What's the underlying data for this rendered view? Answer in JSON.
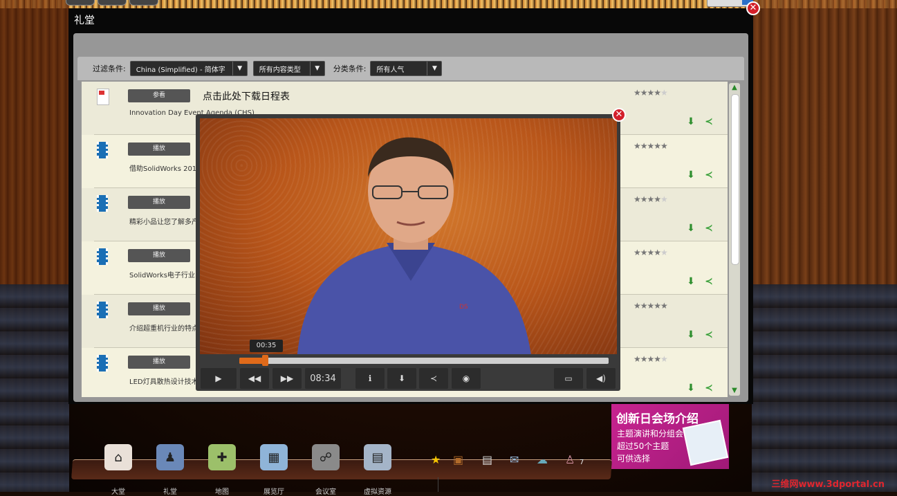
{
  "window": {
    "title": "礼堂"
  },
  "filters": {
    "label1": "过滤条件:",
    "language": "China (Simplified) - 简体字",
    "content_type": "所有内容类型",
    "label2": "分类条件:",
    "popularity": "所有人气"
  },
  "items": [
    {
      "button": "参看",
      "title": "点击此处下载日程表",
      "subtitle": "Innovation Day Event Agenda (CHS)",
      "rating": 4,
      "type": "pdf"
    },
    {
      "button": "播放",
      "title": "",
      "subtitle": "借助SolidWorks 201",
      "rating": 5,
      "type": "video"
    },
    {
      "button": "播放",
      "title": "",
      "subtitle": "精彩小品让您了解多产",
      "rating": 4,
      "type": "video"
    },
    {
      "button": "播放",
      "title": "",
      "subtitle": "SolidWorks电子行业",
      "rating": 4,
      "type": "video"
    },
    {
      "button": "播放",
      "title": "",
      "subtitle": "介绍超重机行业的特点",
      "rating": 5,
      "type": "video"
    },
    {
      "button": "播放",
      "title": "",
      "subtitle": "LED灯具散热设计技术",
      "rating": 4,
      "type": "video"
    }
  ],
  "player": {
    "current_time": "00:35",
    "duration": "08:34",
    "progress": 0.07
  },
  "promo": {
    "heading": "创新日会场介绍",
    "line1": "主题演讲和分组会议",
    "line2": "超过50个主题",
    "line3": "可供选择"
  },
  "dock": {
    "items": [
      {
        "label": "大堂",
        "icon": "house-icon"
      },
      {
        "label": "礼堂",
        "icon": "auditorium-icon"
      },
      {
        "label": "地图",
        "icon": "map-icon"
      },
      {
        "label": "展览厅",
        "icon": "exhibit-icon"
      },
      {
        "label": "会议室",
        "icon": "meeting-icon"
      },
      {
        "label": "虚拟资源",
        "icon": "resources-icon"
      }
    ],
    "people_count": "7"
  },
  "watermark": "三维网www.3dportal.cn",
  "colors": {
    "accent": "#e06a1a",
    "close": "#d31f2a",
    "promo": "#c7238f",
    "star": "#777777"
  }
}
